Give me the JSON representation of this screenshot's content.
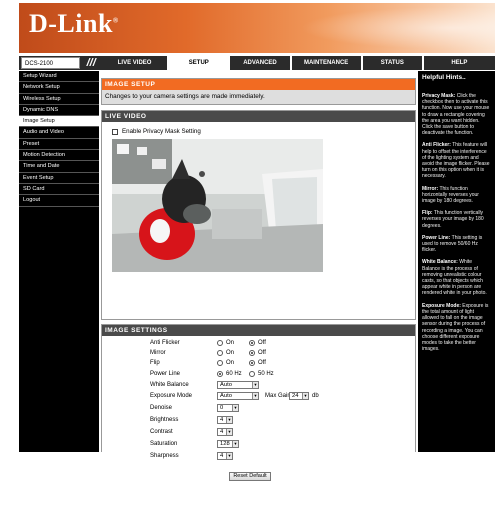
{
  "header": {
    "logo": "D-Link",
    "tm": "®"
  },
  "nav": {
    "model": "DCS-2100",
    "tabs": [
      "LIVE VIDEO",
      "SETUP",
      "ADVANCED",
      "MAINTENANCE",
      "STATUS",
      "HELP"
    ],
    "active_tab": "SETUP"
  },
  "sidebar": {
    "items": [
      "Setup Wizard",
      "Network Setup",
      "Wireless Setup",
      "Dynamic DNS",
      "Image Setup",
      "Audio and Video",
      "Preset",
      "Motion Detection",
      "Time and Date",
      "Event Setup",
      "SD Card",
      "Logout"
    ],
    "active_index": 4
  },
  "image_setup": {
    "title": "IMAGE SETUP",
    "description": "Changes to your camera settings are made immediately."
  },
  "live_video": {
    "title": "LIVE VIDEO",
    "privacy_label": "Enable Privacy Mask Setting"
  },
  "image_settings": {
    "title": "IMAGE SETTINGS",
    "anti_flicker": {
      "label": "Anti Flicker",
      "on": "On",
      "off": "Off",
      "value": "Off"
    },
    "mirror": {
      "label": "Mirror",
      "on": "On",
      "off": "Off",
      "value": "Off"
    },
    "flip": {
      "label": "Flip",
      "on": "On",
      "off": "Off",
      "value": "Off"
    },
    "power_line": {
      "label": "Power Line",
      "opt1": "60 Hz",
      "opt2": "50 Hz",
      "value": "60 Hz"
    },
    "white_balance": {
      "label": "White Balance",
      "value": "Auto"
    },
    "exposure_mode": {
      "label": "Exposure Mode",
      "value": "Auto",
      "max_gain_label": "Max Gain",
      "max_gain_value": "24",
      "unit": "db"
    },
    "denoise": {
      "label": "Denoise",
      "value": "0"
    },
    "brightness": {
      "label": "Brightness",
      "value": "4"
    },
    "contrast": {
      "label": "Contrast",
      "value": "4"
    },
    "saturation": {
      "label": "Saturation",
      "value": "128"
    },
    "sharpness": {
      "label": "Sharpness",
      "value": "4"
    },
    "reset_button": "Reset Default"
  },
  "hints": {
    "title": "Helpful Hints..",
    "items": [
      {
        "head": "Privacy Mask:",
        "text": "Click the checkbox then to activate this function. Now use your mouse to draw a rectangle covering the area you want hidden. Click the save button to deactivate the function."
      },
      {
        "head": "Anti Flicker:",
        "text": "This feature will help to offset the interference of the lighting system and avoid the image flicker. Please turn on this option when it is necessary."
      },
      {
        "head": "Mirror:",
        "text": "This function horizontally reverses your image by 180 degrees."
      },
      {
        "head": "Flip:",
        "text": "This function vertically reverses your image by 180 degrees."
      },
      {
        "head": "Power Line:",
        "text": "This setting is used to remove 50/60 Hz flicker."
      },
      {
        "head": "White Balance:",
        "text": "White Balance is the process of removing unrealistic colour casts, so that objects which appear white in person are rendered white in your photo."
      },
      {
        "head": "Exposure Mode:",
        "text": "Exposure is the total amount of light allowed to fall on the image sensor during the process of recording a image. You can choose different exposure modes to take the better images."
      }
    ]
  }
}
